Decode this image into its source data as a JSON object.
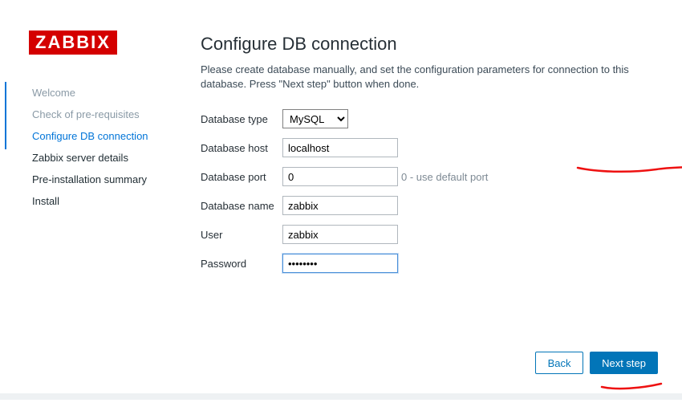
{
  "brand": "ZABBIX",
  "sidebar": {
    "items": [
      {
        "label": "Welcome",
        "state": "done"
      },
      {
        "label": "Check of pre-requisites",
        "state": "done"
      },
      {
        "label": "Configure DB connection",
        "state": "current"
      },
      {
        "label": "Zabbix server details",
        "state": "todo"
      },
      {
        "label": "Pre-installation summary",
        "state": "todo"
      },
      {
        "label": "Install",
        "state": "todo"
      }
    ]
  },
  "main": {
    "title": "Configure DB connection",
    "intro": "Please create database manually, and set the configuration parameters for connection to this database. Press \"Next step\" button when done.",
    "fields": {
      "db_type_label": "Database type",
      "db_type_value": "MySQL",
      "db_host_label": "Database host",
      "db_host_value": "localhost",
      "db_port_label": "Database port",
      "db_port_value": "0",
      "db_port_hint": "0 - use default port",
      "db_name_label": "Database name",
      "db_name_value": "zabbix",
      "user_label": "User",
      "user_value": "zabbix",
      "password_label": "Password",
      "password_value": "••••••••"
    }
  },
  "footer": {
    "back": "Back",
    "next": "Next step"
  }
}
